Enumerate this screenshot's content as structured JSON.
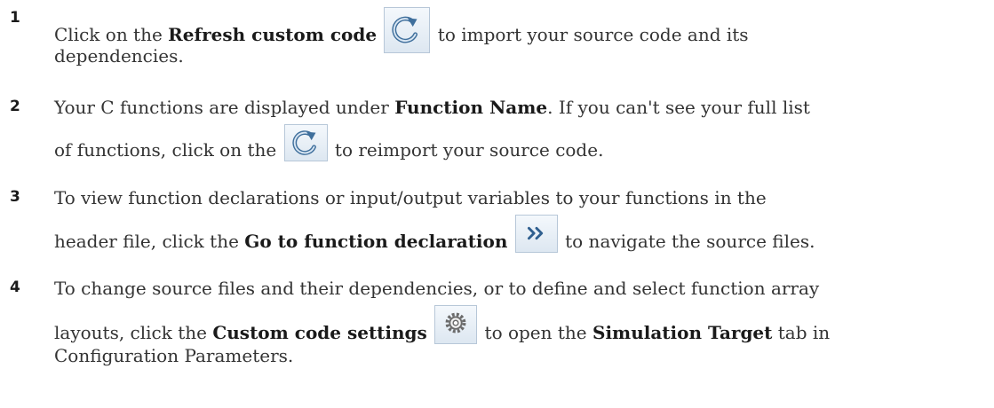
{
  "steps": [
    {
      "number": "1",
      "before_bold": "Click on the ",
      "bold": "Refresh custom code",
      "icon": "refresh-icon",
      "after_icon": " to import your source code and its",
      "line2": "dependencies."
    },
    {
      "number": "2",
      "line1_before": "Your C functions are displayed under ",
      "line1_bold": "Function Name",
      "line1_after": ". If you can't see your full list",
      "line2_before": "of functions, click on the ",
      "icon": "refresh-icon",
      "line2_after": " to reimport your source code."
    },
    {
      "number": "3",
      "line1": "To view function declarations or input/output variables to your functions in the",
      "line2_before": "header file, click the ",
      "line2_bold": "Go to function declaration",
      "icon": "double-chevron-right-icon",
      "line2_after": " to navigate the source files."
    },
    {
      "number": "4",
      "line1": "To change source files and their dependencies, or to define and select function array",
      "line2_before": "layouts, click the ",
      "line2_bold": "Custom code settings",
      "icon": "gear-icon",
      "line2_mid": " to open the ",
      "line2_bold2": "Simulation Target",
      "line2_after": " tab in",
      "line3": "Configuration Parameters."
    }
  ]
}
